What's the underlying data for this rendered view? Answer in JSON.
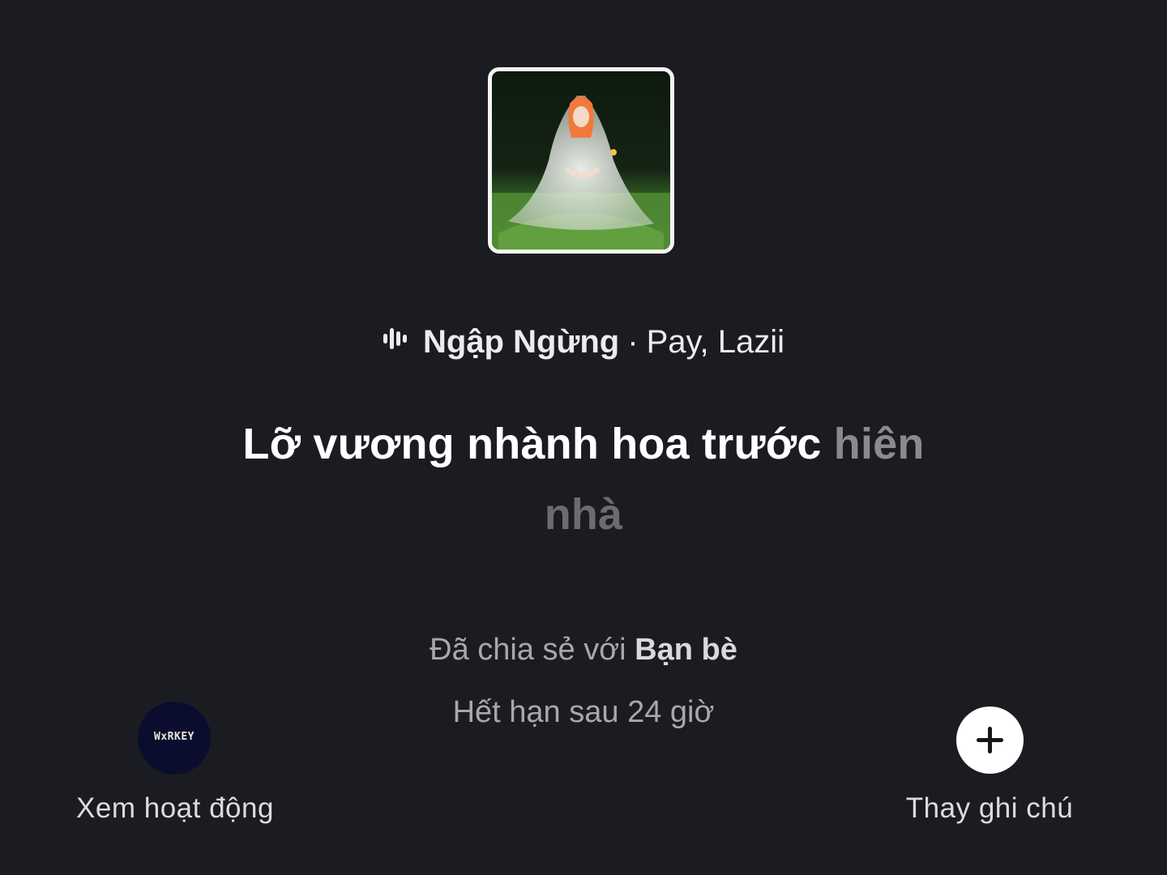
{
  "now_playing": {
    "cover_alt": "album-cover",
    "song_title": "Ngập Ngừng",
    "separator": "·",
    "artists": "Pay, Lazii"
  },
  "lyrics": {
    "sung": "Lỡ vương nhành hoa trước",
    "unsung": "hiên",
    "unsung_line2": "nhà"
  },
  "sharing": {
    "prefix": "Đã chia sẻ với",
    "audience": "Bạn bè",
    "expiry": "Hết hạn sau 24 giờ"
  },
  "actions": {
    "view_activity": {
      "avatar_text": "WxRKEY",
      "label": "Xem hoạt động"
    },
    "change_note": {
      "label": "Thay ghi chú",
      "icon": "plus-icon"
    }
  },
  "colors": {
    "background": "#1b1c21",
    "lyric_sung": "#ffffff",
    "lyric_unsung": "#8a8b90",
    "muted_text": "#a7a8ad"
  }
}
